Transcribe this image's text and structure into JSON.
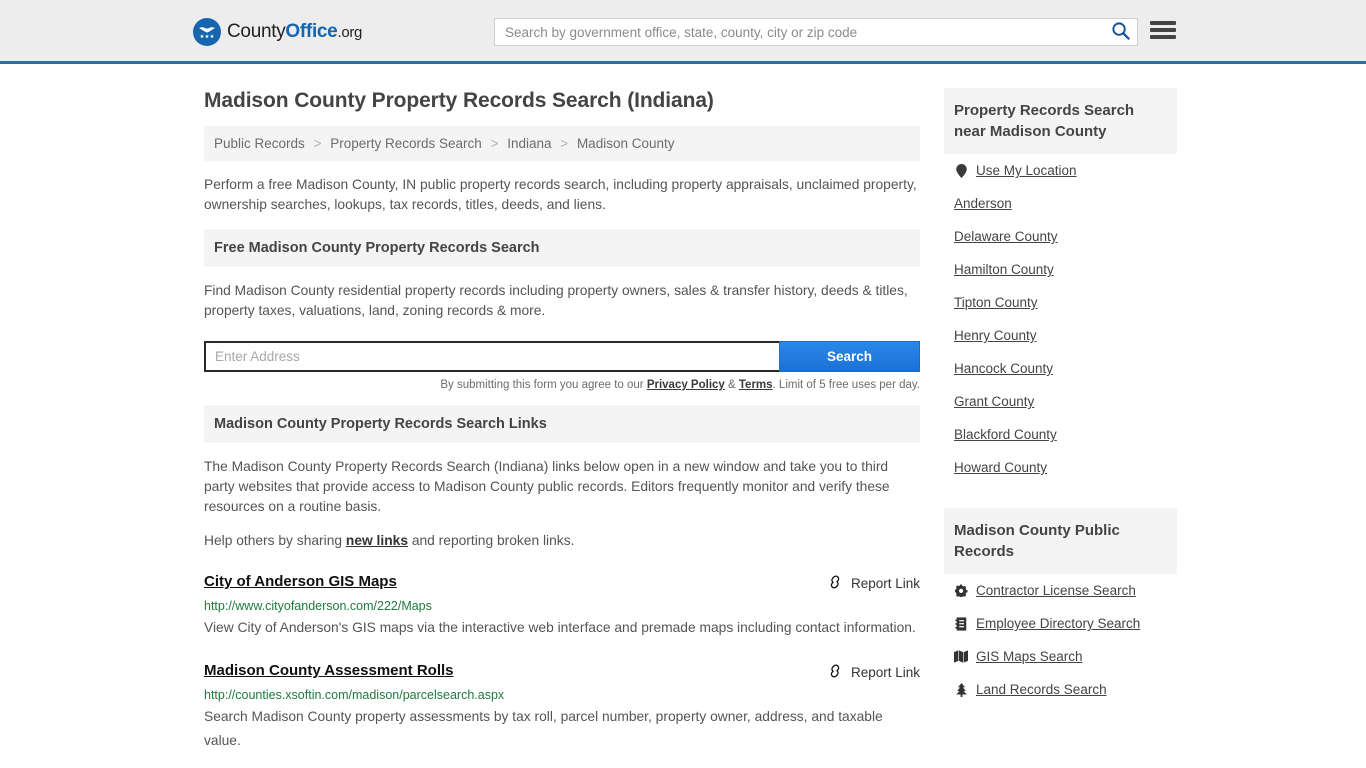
{
  "header": {
    "logo": {
      "part1": "County",
      "part2": "Office",
      "part3": ".org",
      "icon": "eagle-shield-logo"
    },
    "search": {
      "placeholder": "Search by government office, state, county, city or zip code",
      "value": "",
      "icon": "search-icon"
    },
    "menu_icon": "hamburger-menu-icon",
    "accent_color": "#2e6da4"
  },
  "main": {
    "page_title": "Madison County Property Records Search (Indiana)",
    "breadcrumb": [
      "Public Records",
      "Property Records Search",
      "Indiana",
      "Madison County"
    ],
    "breadcrumb_separator": ">",
    "intro": "Perform a free Madison County, IN public property records search, including property appraisals, unclaimed property, ownership searches, lookups, tax records, titles, deeds, and liens.",
    "free_search": {
      "heading": "Free Madison County Property Records Search",
      "description": "Find Madison County residential property records including property owners, sales & transfer history, deeds & titles, property taxes, valuations, land, zoning records & more.",
      "input_placeholder": "Enter Address",
      "input_value": "",
      "button_label": "Search",
      "button_color": "#1b72d6",
      "note_prefix": "By submitting this form you agree to our ",
      "note_privacy": "Privacy Policy",
      "note_amp": " & ",
      "note_terms": "Terms",
      "note_suffix": ". Limit of 5 free uses per day."
    },
    "links_section": {
      "heading": "Madison County Property Records Search Links",
      "paragraph": "The Madison County Property Records Search (Indiana) links below open in a new window and take you to third party websites that provide access to Madison County public records. Editors frequently monitor and verify these resources on a routine basis.",
      "share_prefix": "Help others by sharing ",
      "share_link": "new links",
      "share_suffix": " and reporting broken links.",
      "report_label": "Report Link",
      "report_icon": "broken-link-icon",
      "items": [
        {
          "title": "City of Anderson GIS Maps",
          "url": "http://www.cityofanderson.com/222/Maps",
          "description": "View City of Anderson's GIS maps via the interactive web interface and premade maps including contact information."
        },
        {
          "title": "Madison County Assessment Rolls",
          "url": "http://counties.xsoftin.com/madison/parcelsearch.aspx",
          "description": "Search Madison County property assessments by tax roll, parcel number, property owner, address, and taxable value."
        }
      ]
    }
  },
  "sidebar": {
    "nearby": {
      "heading": "Property Records Search near Madison County",
      "items": [
        {
          "label": "Use My Location",
          "icon": "map-pin-icon"
        },
        {
          "label": "Anderson",
          "icon": ""
        },
        {
          "label": "Delaware County",
          "icon": ""
        },
        {
          "label": "Hamilton County",
          "icon": ""
        },
        {
          "label": "Tipton County",
          "icon": ""
        },
        {
          "label": "Henry County",
          "icon": ""
        },
        {
          "label": "Hancock County",
          "icon": ""
        },
        {
          "label": "Grant County",
          "icon": ""
        },
        {
          "label": "Blackford County",
          "icon": ""
        },
        {
          "label": "Howard County",
          "icon": ""
        }
      ]
    },
    "public_records": {
      "heading": "Madison County Public Records",
      "items": [
        {
          "label": "Contractor License Search",
          "icon": "gear-icon"
        },
        {
          "label": "Employee Directory Search",
          "icon": "address-book-icon"
        },
        {
          "label": "GIS Maps Search",
          "icon": "map-icon"
        },
        {
          "label": "Land Records Search",
          "icon": "tree-icon"
        }
      ]
    }
  }
}
